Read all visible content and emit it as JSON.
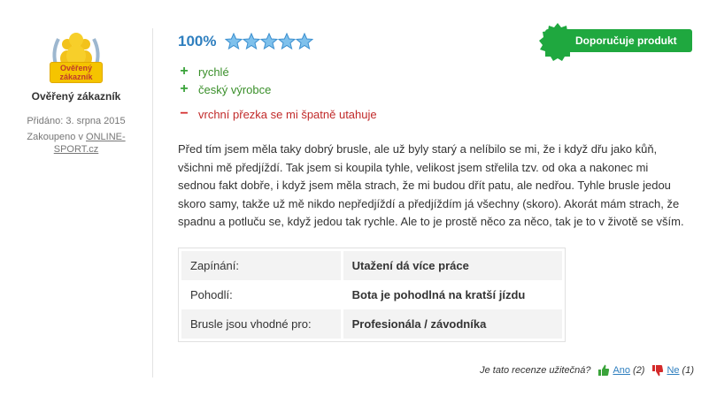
{
  "author": {
    "badge_line1": "Ověřený",
    "badge_line2": "zákazník",
    "title": "Ověřený zákazník",
    "added": "Přidáno: 3. srpna 2015",
    "purchased_prefix": "Zakoupeno v ",
    "purchased_shop_line1": "ONLINE-",
    "purchased_shop_line2": "SPORT.cz"
  },
  "rating": {
    "percent": "100%",
    "stars": 5,
    "max_stars": 5
  },
  "recommend": {
    "label": "Doporučuje produkt"
  },
  "pros": [
    "rychlé",
    "český výrobce"
  ],
  "cons": [
    "vrchní přezka se mi špatně utahuje"
  ],
  "review_text": "Před tím jsem měla taky dobrý brusle, ale už byly starý a nelíbilo se mi, že i když dřu jako kůň, všichni mě předjíždí. Tak jsem si koupila tyhle, velikost jsem střelila tzv. od oka a nakonec mi sednou fakt dobře, i když jsem měla strach, že mi budou dřít patu, ale nedřou. Tyhle brusle jedou skoro samy, takže už mě nikdo nepředjíždí a předjíždím já všechny (skoro). Akorát mám strach, že spadnu a potluču se, když jedou tak rychle. Ale to je prostě něco za něco, tak je to v životě se vším.",
  "params": [
    {
      "label": "Zapínání:",
      "value": "Utažení dá více práce"
    },
    {
      "label": "Pohodlí:",
      "value": "Bota je pohodlná na kratší jízdu"
    },
    {
      "label": "Brusle jsou vhodné pro:",
      "value": "Profesionála / závodníka"
    }
  ],
  "useful": {
    "question": "Je tato recenze užitečná?",
    "yes_label": "Ano",
    "yes_count": "(2)",
    "no_label": "Ne",
    "no_count": "(1)"
  },
  "colors": {
    "accent_blue": "#2f7fbf",
    "green": "#1fa83f",
    "red": "#d42a2a",
    "badge_gold": "#f5c400"
  }
}
